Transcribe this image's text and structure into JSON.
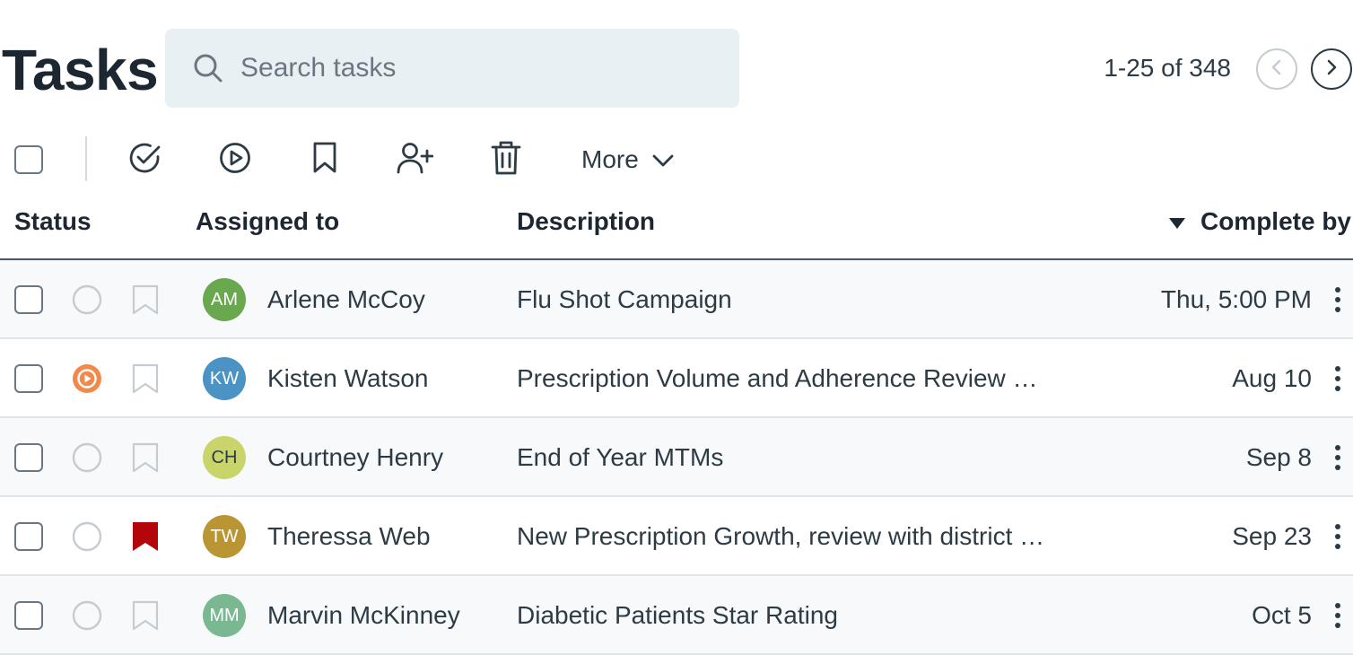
{
  "header": {
    "title": "Tasks",
    "search_placeholder": "Search tasks",
    "pagination": "1-25 of 348"
  },
  "toolbar": {
    "actions": [
      {
        "name": "complete-check-icon",
        "label": "Mark complete"
      },
      {
        "name": "play-icon",
        "label": "Start"
      },
      {
        "name": "bookmark-icon",
        "label": "Bookmark"
      },
      {
        "name": "user-plus-icon",
        "label": "Assign"
      },
      {
        "name": "trash-icon",
        "label": "Delete"
      }
    ],
    "more_label": "More"
  },
  "columns": {
    "status": "Status",
    "assigned": "Assigned to",
    "description": "Description",
    "complete_by": "Complete by",
    "sort": "descending"
  },
  "rows": [
    {
      "status": "not-started",
      "flagged": false,
      "initials": "AM",
      "avatar_color": "#6aa84f",
      "name": "Arlene McCoy",
      "description": "Flu Shot Campaign",
      "due": "Thu, 5:00 PM"
    },
    {
      "status": "in-progress",
      "flagged": false,
      "initials": "KW",
      "avatar_color": "#4a93c4",
      "name": "Kisten Watson",
      "description": "Prescription Volume and Adherence Review with pharmacy team",
      "due": "Aug 10"
    },
    {
      "status": "not-started",
      "flagged": false,
      "initials": "CH",
      "avatar_color": "#c9d46a",
      "name": "Courtney Henry",
      "description": "End of Year MTMs",
      "due": "Sep 8"
    },
    {
      "status": "not-started",
      "flagged": true,
      "initials": "TW",
      "avatar_color": "#b99534",
      "name": "Theressa Web",
      "description": "New Prescription Growth, review with district managers",
      "due": "Sep 23"
    },
    {
      "status": "not-started",
      "flagged": false,
      "initials": "MM",
      "avatar_color": "#7ab892",
      "name": "Marvin McKinney",
      "description": "Diabetic Patients Star Rating",
      "due": "Oct 5"
    }
  ],
  "colors": {
    "in_progress": "#f0894a",
    "flag": "#b3060a",
    "text": "#2d3b45"
  }
}
